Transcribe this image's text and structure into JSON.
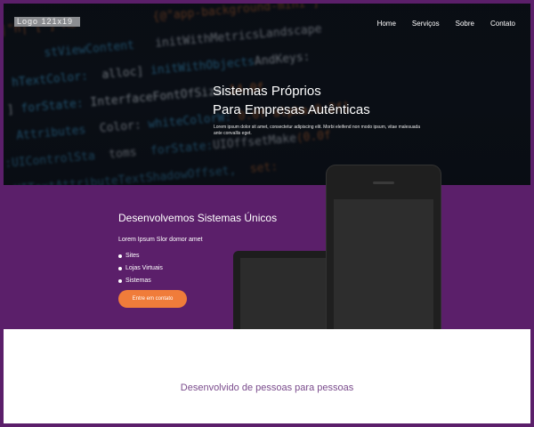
{
  "header": {
    "logo_text": "Logo 121x19",
    "nav": [
      {
        "label": "Home"
      },
      {
        "label": "Serviços"
      },
      {
        "label": "Sobre"
      },
      {
        "label": "Contato"
      }
    ]
  },
  "hero": {
    "title_line1": "Sistemas Próprios",
    "title_line2": "Para Empresas Autênticas",
    "text": "Lorem ipsum dolor sit amet, consectetur adipiscing elit. Morbi eleifend non modo ipsum, vitae malesuada ante convallis eget."
  },
  "features_section": {
    "title": "Desenvolvemos Sistemas Únicos",
    "intro": "Lorem Ipsum Slor domor amet",
    "items": [
      "Sites",
      "Lojas Virtuais",
      "Sistemas"
    ],
    "cta_label": "Entre em contato"
  },
  "footer_section": {
    "tagline": "Desenvolvido de pessoas para pessoas"
  },
  "colors": {
    "brand_purple": "#5b1f6a",
    "accent_orange": "#f07c3a",
    "tagline_purple": "#7a4b8c"
  }
}
